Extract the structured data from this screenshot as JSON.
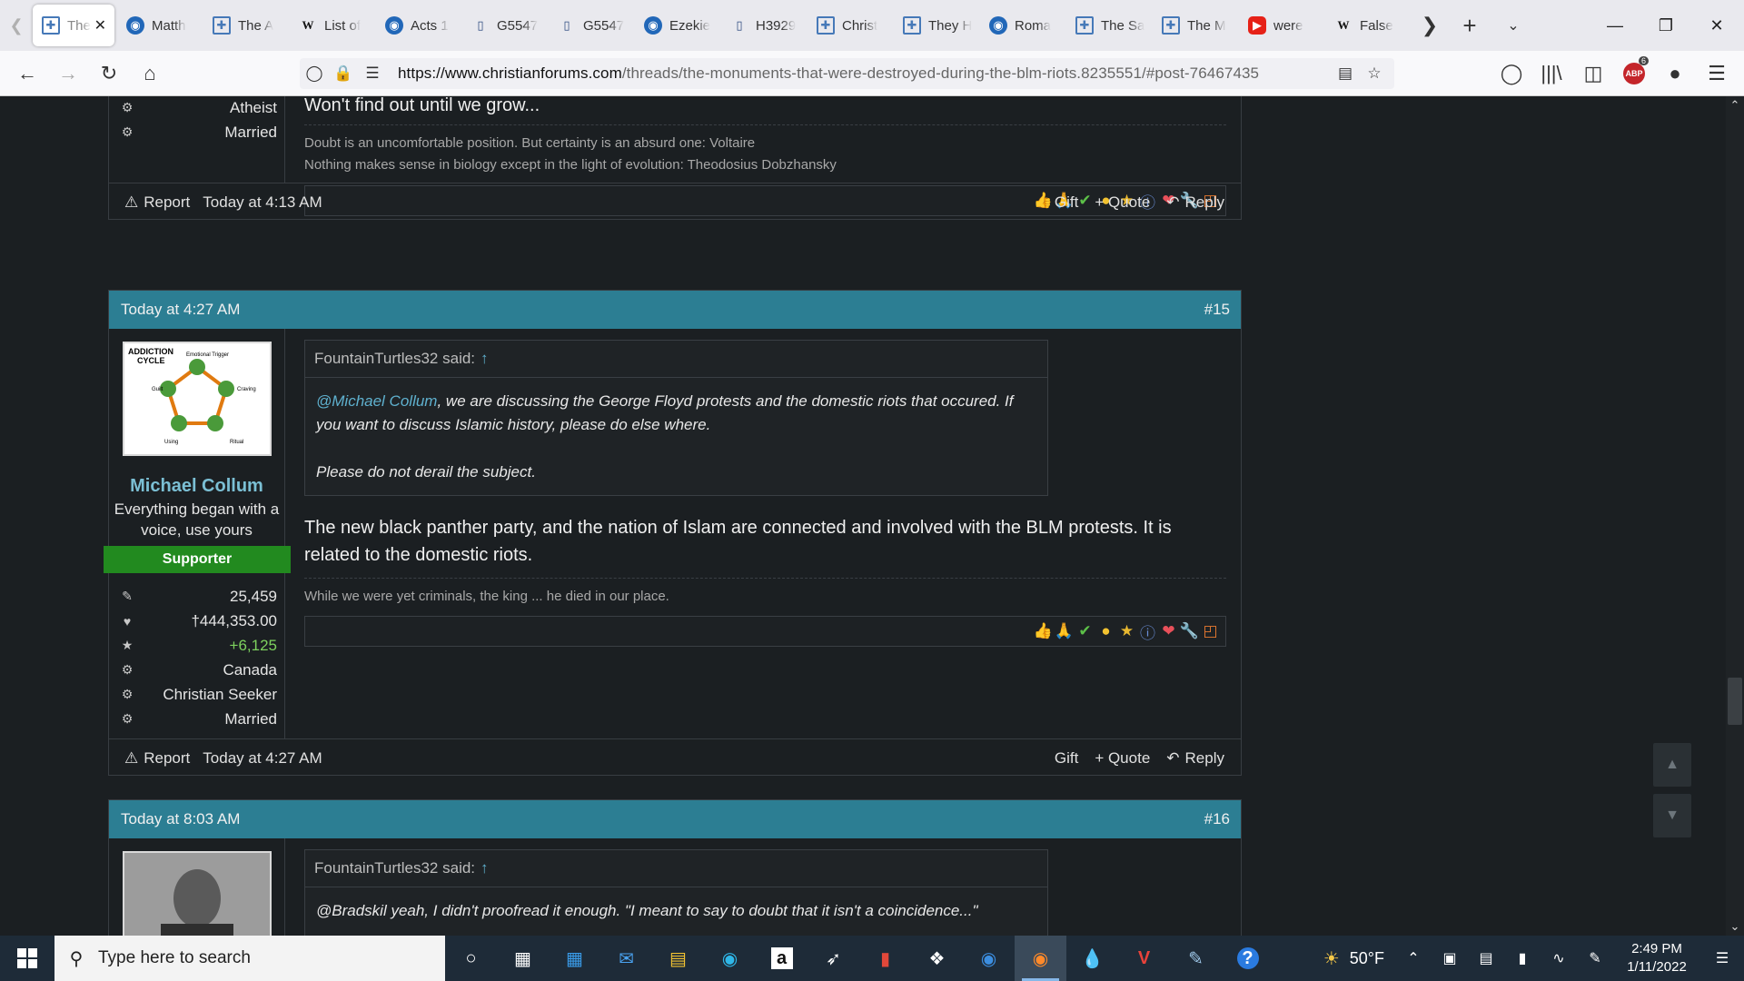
{
  "browser": {
    "tabs": [
      {
        "title": "The",
        "icon": "cf",
        "active": true
      },
      {
        "title": "Matth",
        "icon": "bible"
      },
      {
        "title": "The A",
        "icon": "cf"
      },
      {
        "title": "List of",
        "icon": "w"
      },
      {
        "title": "Acts 1",
        "icon": "bible"
      },
      {
        "title": "G5547",
        "icon": "book"
      },
      {
        "title": "G5547",
        "icon": "book"
      },
      {
        "title": "Ezekie",
        "icon": "bible"
      },
      {
        "title": "H3929",
        "icon": "book"
      },
      {
        "title": "Christ",
        "icon": "cf"
      },
      {
        "title": "They H",
        "icon": "cf"
      },
      {
        "title": "Roma",
        "icon": "bible"
      },
      {
        "title": "The Sa",
        "icon": "cf"
      },
      {
        "title": "The M",
        "icon": "cf"
      },
      {
        "title": "were",
        "icon": "yt"
      },
      {
        "title": "False",
        "icon": "w"
      }
    ],
    "url_domain": "https://www.christianforums.com",
    "url_path": "/threads/the-monuments-that-were-destroyed-during-the-blm-riots.8235551/#post-76467435",
    "extension_badge": "6"
  },
  "prev_post": {
    "stats": [
      {
        "icon": "gear-icon",
        "value": "Atheist"
      },
      {
        "icon": "gear-icon",
        "value": "Married"
      }
    ],
    "text_tail": "Won't find out until we grow...",
    "signature": [
      "Doubt is an uncomfortable position. But certainty is an absurd one: Voltaire",
      "Nothing makes sense in biology except in the light of evolution: Theodosius Dobzhansky"
    ],
    "report_label": "Report",
    "time": "Today at 4:13 AM",
    "gift_label": "Gift",
    "quote_label": "+ Quote",
    "reply_label": "Reply"
  },
  "post15": {
    "date": "Today at 4:27 AM",
    "number": "#15",
    "avatar_text": {
      "title_line1": "ADDICTION",
      "title_line2": "CYCLE",
      "top": "Emotional Trigger",
      "left": "Guilt",
      "right": "Craving",
      "bottom_left": "Using",
      "bottom_right": "Ritual"
    },
    "username": "Michael Collum",
    "user_title": "Everything began with a voice, use yours",
    "banner": "Supporter",
    "stats": [
      {
        "icon": "messages-icon",
        "value": "25,459"
      },
      {
        "icon": "heart-icon",
        "value": "†444,353.00"
      },
      {
        "icon": "star-icon",
        "value": "+6,125"
      },
      {
        "icon": "gear-icon",
        "value": "Canada"
      },
      {
        "icon": "gear-icon",
        "value": "Christian Seeker"
      },
      {
        "icon": "gear-icon",
        "value": "Married"
      }
    ],
    "quote_author": "FountainTurtles32 said:",
    "quote_arrow": "↑",
    "quote_mention": "@Michael Collum",
    "quote_line1_rest": ", we are discussing the George Floyd protests and the domestic riots that occured. If you want to discuss Islamic history, please do else where.",
    "quote_line2": "Please do not derail the subject.",
    "message": "The new black panther party, and the nation of Islam are connected and involved with the BLM protests. It is related to the domestic riots.",
    "signature": "While we were yet criminals, the king ... he died in our place.",
    "report_label": "Report",
    "time": "Today at 4:27 AM",
    "gift_label": "Gift",
    "quote_label": "+ Quote",
    "reply_label": "Reply"
  },
  "post16": {
    "date": "Today at 8:03 AM",
    "number": "#16",
    "quote_author": "FountainTurtles32 said:",
    "quote_arrow": "↑",
    "quote_text": "@Bradskil yeah, I didn't proofread it enough. \"I meant to say to doubt that it isn't a coincidence...\""
  },
  "reactions": [
    "thumbs-up-icon",
    "praying-icon",
    "check-icon",
    "neutral-icon",
    "medal-icon",
    "info-icon",
    "heart-icon",
    "wrench-icon",
    "rainbow-icon"
  ],
  "taskbar": {
    "search_placeholder": "Type here to search",
    "weather": "50°F",
    "time": "2:49 PM",
    "date": "1/11/2022"
  }
}
